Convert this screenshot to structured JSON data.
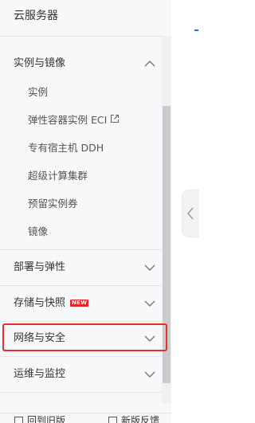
{
  "sidebar": {
    "title": "云服务器",
    "groups": [
      {
        "label": "实例与镜像",
        "expanded": true,
        "items": [
          {
            "label": "实例"
          },
          {
            "label": "弹性容器实例 ECI",
            "external": true
          },
          {
            "label": "专有宿主机 DDH"
          },
          {
            "label": "超级计算集群"
          },
          {
            "label": "预留实例券"
          },
          {
            "label": "镜像"
          }
        ]
      },
      {
        "label": "部署与弹性",
        "expanded": false
      },
      {
        "label": "存储与快照",
        "expanded": false,
        "badge": "NEW"
      },
      {
        "label": "网络与安全",
        "expanded": false,
        "highlighted": true
      },
      {
        "label": "运维与监控",
        "expanded": false
      }
    ]
  },
  "footer": {
    "left_label": "回到旧版",
    "right_label": "新版反馈"
  },
  "colors": {
    "highlight_border": "#e52e2e",
    "badge_bg": "#e3262b",
    "accent": "#1f6fde"
  },
  "icons": {
    "expanded": "chevron-up-icon",
    "collapsed": "chevron-down-icon",
    "external": "external-link-icon",
    "collapse_handle": "chevron-left-icon"
  }
}
